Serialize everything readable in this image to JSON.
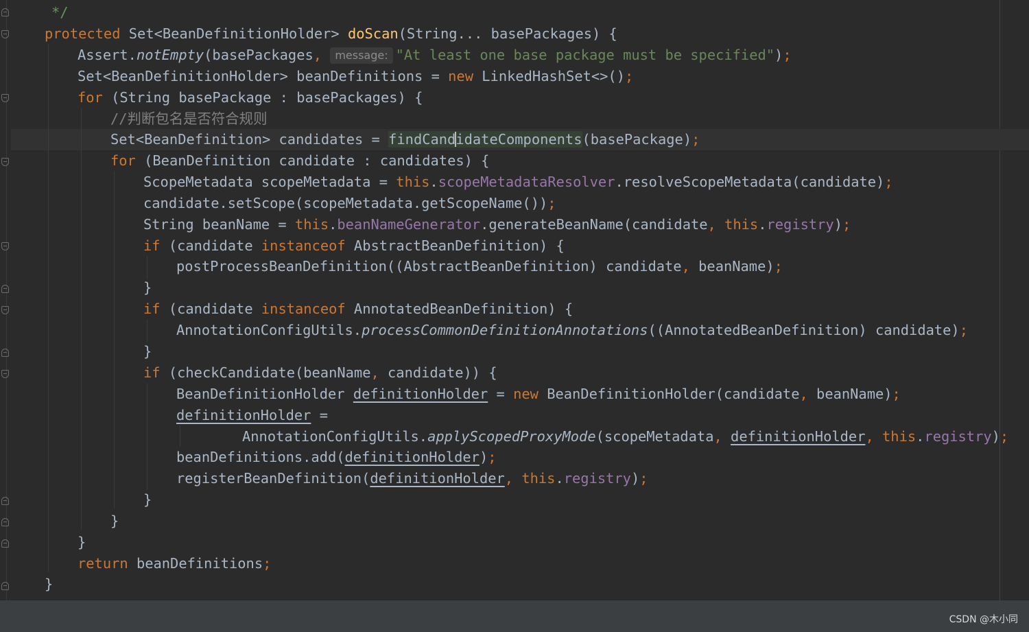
{
  "editor": {
    "hint": "message:",
    "lines": {
      "l0": {
        "c1": "*/"
      },
      "l1": {
        "k1": "protected",
        "t1": " Set<BeanDefinitionHolder> ",
        "f1": "doScan",
        "t2": "(String... basePackages) {"
      },
      "l2": {
        "t1": "Assert.",
        "i1": "notEmpty",
        "t2": "(basePackages",
        "p1": ",",
        "s1": "\"At least one base package must be specified\"",
        "t3": ")",
        "p2": ";"
      },
      "l3": {
        "t1": "Set<BeanDefinitionHolder> beanDefinitions = ",
        "k1": "new",
        "t2": " LinkedHashSet<>()",
        "p1": ";"
      },
      "l4": {
        "k1": "for",
        "t1": " (String basePackage : basePackages) {"
      },
      "l5": {
        "c1": "//判断包名是否符合规则"
      },
      "l6": {
        "t1": "Set<BeanDefinition> candidates = ",
        "h1": "findCand",
        "h2": "idateComponents",
        "t2": "(basePackage)",
        "p1": ";"
      },
      "l7": {
        "k1": "for",
        "t1": " (BeanDefinition candidate : candidates) {"
      },
      "l8": {
        "t1": "ScopeMetadata scopeMetadata = ",
        "k1": "this",
        "t2": ".",
        "v1": "scopeMetadataResolver",
        "t3": ".resolveScopeMetadata(candidate)",
        "p1": ";"
      },
      "l9": {
        "t1": "candidate.setScope(scopeMetadata.getScopeName())",
        "p1": ";"
      },
      "l10": {
        "t1": "String beanName = ",
        "k1": "this",
        "t2": ".",
        "v1": "beanNameGenerator",
        "t3": ".generateBeanName(candidate",
        "p1": ",",
        "k2": " this",
        "t4": ".",
        "v2": "registry",
        "t5": ")",
        "p2": ";"
      },
      "l11": {
        "k1": "if",
        "t1": " (candidate ",
        "k2": "instanceof",
        "t2": " AbstractBeanDefinition) {"
      },
      "l12": {
        "t1": "postProcessBeanDefinition((AbstractBeanDefinition) candidate",
        "p1": ",",
        "t2": " beanName)",
        "p2": ";"
      },
      "l13": {
        "t1": "}"
      },
      "l14": {
        "k1": "if",
        "t1": " (candidate ",
        "k2": "instanceof",
        "t2": " AnnotatedBeanDefinition) {"
      },
      "l15": {
        "t1": "AnnotationConfigUtils.",
        "i1": "processCommonDefinitionAnnotations",
        "t2": "((AnnotatedBeanDefinition) candidate)",
        "p1": ";"
      },
      "l16": {
        "t1": "}"
      },
      "l17": {
        "k1": "if",
        "t1": " (checkCandidate(beanName",
        "p1": ",",
        "t2": " candidate)) {"
      },
      "l18": {
        "t1": "BeanDefinitionHolder ",
        "u1": "definitionHolder",
        "t2": " = ",
        "k1": "new",
        "t3": " BeanDefinitionHolder(candidate",
        "p1": ",",
        "t4": " beanName)",
        "p2": ";"
      },
      "l19": {
        "u1": "definitionHolder",
        "t1": " ="
      },
      "l20": {
        "t1": "AnnotationConfigUtils.",
        "i1": "applyScopedProxyMode",
        "t2": "(scopeMetadata",
        "p1": ",",
        "t3": " ",
        "u1": "definitionHolder",
        "p2": ",",
        "k1": " this",
        "t4": ".",
        "v1": "registry",
        "t5": ")",
        "p3": ";"
      },
      "l21": {
        "t1": "beanDefinitions.add(",
        "u1": "definitionHolder",
        "t2": ")",
        "p1": ";"
      },
      "l22": {
        "t1": "registerBeanDefinition(",
        "u1": "definitionHolder",
        "p1": ",",
        "k1": " this",
        "t2": ".",
        "v1": "registry",
        "t3": ")",
        "p2": ";"
      },
      "l23": {
        "t1": "}"
      },
      "l24": {
        "t1": "}"
      },
      "l25": {
        "t1": "}"
      },
      "l26": {
        "k1": "return",
        "t1": " beanDefinitions",
        "p1": ";"
      },
      "l27": {
        "t1": "}"
      }
    }
  },
  "watermark": "CSDN @木小同",
  "colors": {
    "background": "#2b2b2b",
    "keyword": "#cc7832",
    "method_decl": "#ffc66d",
    "string": "#6a8759",
    "comment": "#808080",
    "field": "#9876aa",
    "text": "#a9b7c6"
  }
}
